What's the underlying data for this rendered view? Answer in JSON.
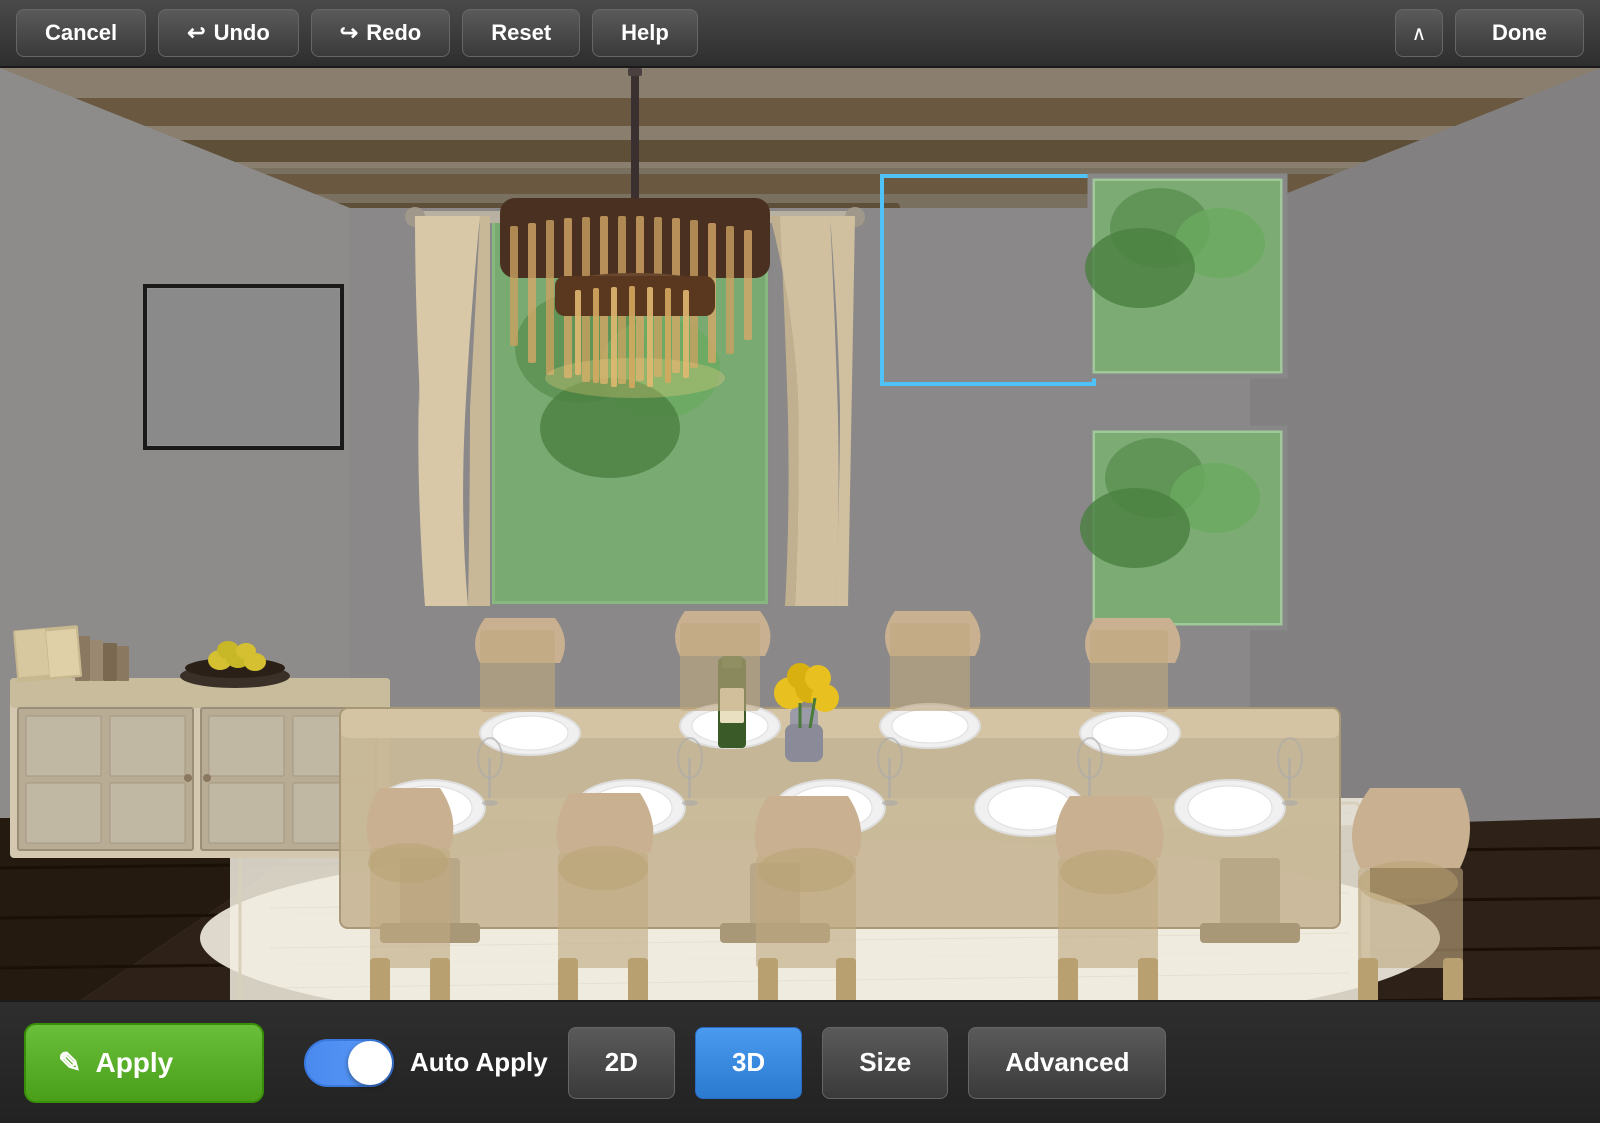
{
  "toolbar": {
    "cancel_label": "Cancel",
    "undo_label": "Undo",
    "redo_label": "Redo",
    "reset_label": "Reset",
    "help_label": "Help",
    "done_label": "Done"
  },
  "bottom": {
    "apply_label": "Apply",
    "auto_apply_label": "Auto Apply",
    "view_2d_label": "2D",
    "view_3d_label": "3D",
    "size_label": "Size",
    "advanced_label": "Advanced",
    "apply_icon": "✎",
    "toggle_active": true,
    "active_view": "3D"
  },
  "scene": {
    "description": "Dining room with chandelier, dining table, chairs, sideboard, windows, curtains"
  }
}
